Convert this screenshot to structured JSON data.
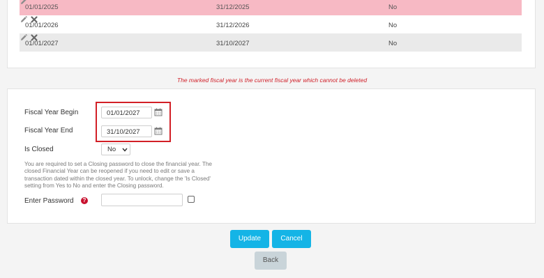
{
  "fiscal_years": [
    {
      "begin": "01/01/2025",
      "end": "31/12/2025",
      "closed": "No",
      "current": true
    },
    {
      "begin": "01/01/2026",
      "end": "31/12/2026",
      "closed": "No",
      "current": false
    },
    {
      "begin": "01/01/2027",
      "end": "31/10/2027",
      "closed": "No",
      "current": false
    }
  ],
  "note": "The marked fiscal year is the current fiscal year which cannot be deleted",
  "form": {
    "begin_label": "Fiscal Year Begin",
    "begin_value": "01/01/2027",
    "end_label": "Fiscal Year End",
    "end_value": "31/10/2027",
    "closed_label": "Is Closed",
    "closed_value": "No",
    "help_text": "You are required to set a Closing password to close the financial year. The closed Financial Year can be reopened if you need to edit or save a transaction dated within the closed year. To unlock, change the 'Is Closed' setting from Yes to No and enter the Closing password.",
    "password_label": "Enter Password",
    "password_help_icon": "?"
  },
  "buttons": {
    "update": "Update",
    "cancel": "Cancel",
    "back": "Back"
  },
  "colors": {
    "current_row": "#f7b9c4",
    "alt_row": "#eaeaea",
    "primary_button": "#14b4e6",
    "back_button": "#c9d4d9",
    "highlight": "#d21f26",
    "note_text": "#d0212a"
  },
  "icons": {
    "edit": "pencil-icon",
    "delete": "close-icon",
    "calendar": "calendar-icon",
    "select": "chevron-down-icon",
    "help": "question-icon"
  }
}
